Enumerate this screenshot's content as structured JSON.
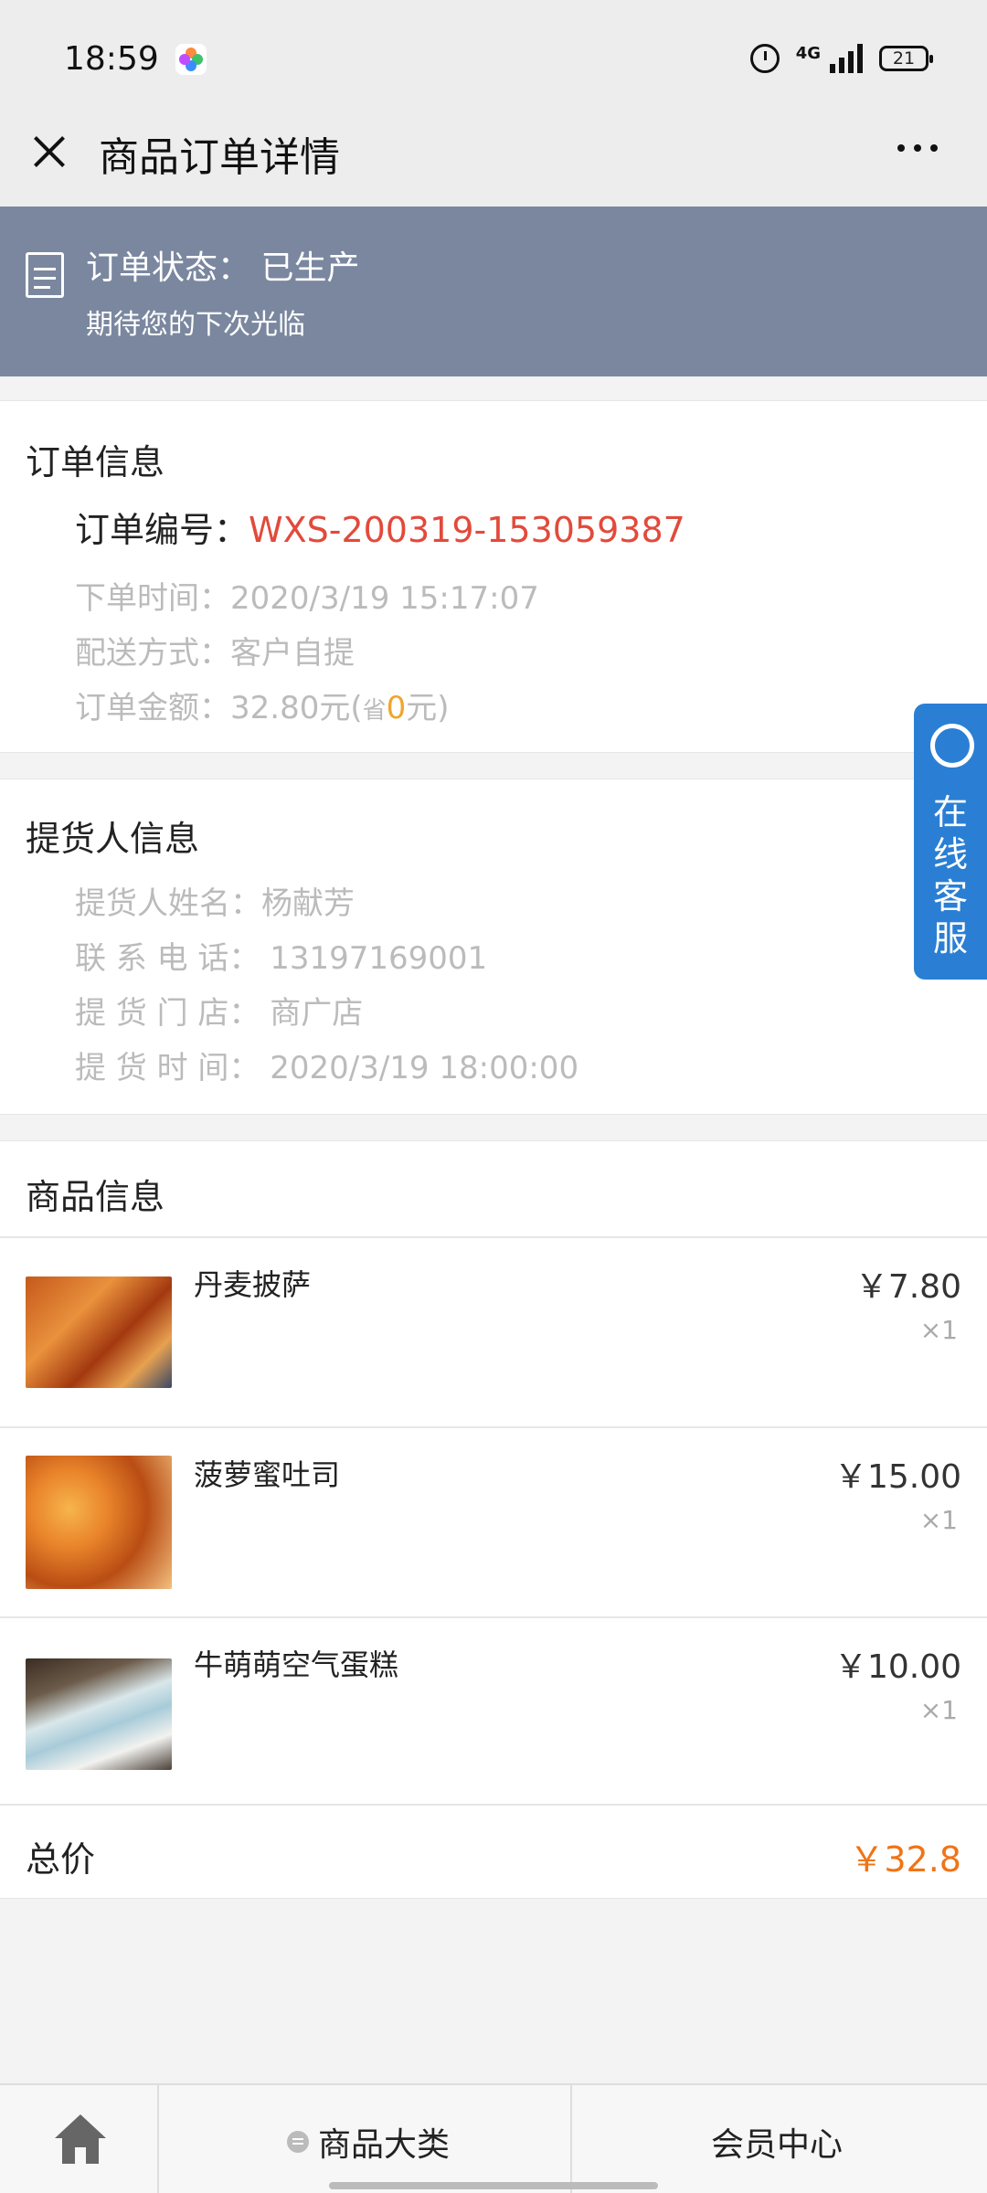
{
  "status_bar": {
    "time": "18:59",
    "network": "4G",
    "battery": "21"
  },
  "header": {
    "title": "商品订单详情"
  },
  "order_status": {
    "title": "订单状态： 已生产",
    "subtitle": "期待您的下次光临"
  },
  "order_info": {
    "section_title": "订单信息",
    "order_no_label": "订单编号：",
    "order_no_value": "WXS-200319-153059387",
    "order_time": "下单时间：2020/3/19 15:17:07",
    "delivery": "配送方式：客户自提",
    "amount_prefix": "订单金额：32.80元(",
    "saved_prefix": "省",
    "saved_value": "0",
    "saved_suffix": "元)"
  },
  "pickup_info": {
    "section_title": "提货人信息",
    "name": "提货人姓名：杨献芳",
    "phone": "联 系 电 话： 13197169001",
    "store": "提 货 门 店： 商广店",
    "time": "提 货 时 间： 2020/3/19 18:00:00"
  },
  "products": {
    "section_title": "商品信息",
    "items": [
      {
        "name": "丹麦披萨",
        "price": "￥7.80",
        "qty": "×1"
      },
      {
        "name": "菠萝蜜吐司",
        "price": "￥15.00",
        "qty": "×1"
      },
      {
        "name": "牛萌萌空气蛋糕",
        "price": "￥10.00",
        "qty": "×1"
      }
    ]
  },
  "total": {
    "label": "总价",
    "value": "￥32.8"
  },
  "service_tab": {
    "label": "在线客服"
  },
  "bottom_nav": {
    "category_label": "商品大类",
    "member_label": "会员中心"
  },
  "colors": {
    "banner": "#7a879f",
    "order_no": "#e24a3b",
    "total": "#f07418",
    "service": "#2a7fd4"
  }
}
